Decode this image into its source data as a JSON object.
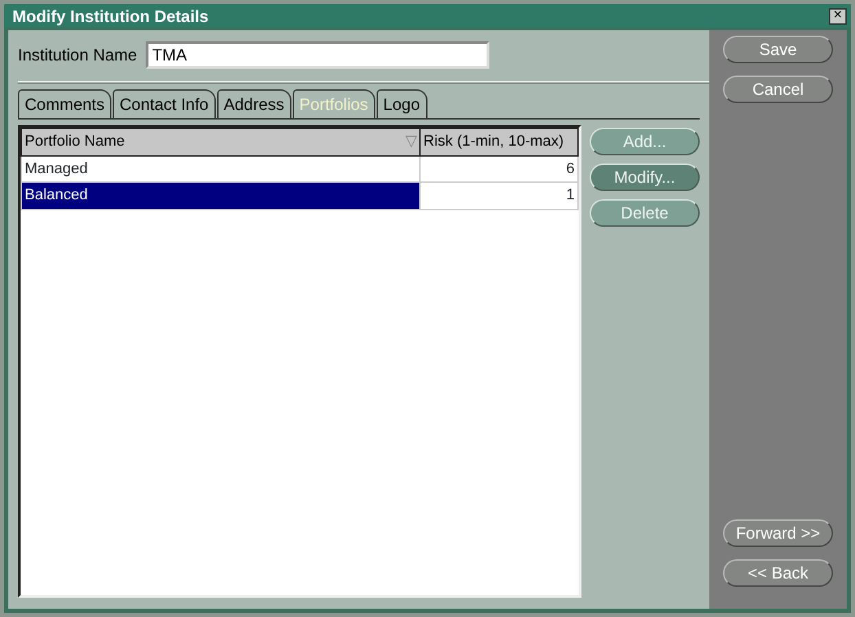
{
  "window": {
    "title": "Modify Institution Details",
    "close": "×"
  },
  "institution_name": {
    "label": "Institution Name",
    "value": "TMA"
  },
  "tabs": [
    {
      "label": "Comments",
      "selected": false
    },
    {
      "label": "Contact Info",
      "selected": false
    },
    {
      "label": "Address",
      "selected": false
    },
    {
      "label": "Portfolios",
      "selected": true
    },
    {
      "label": "Logo",
      "selected": false
    }
  ],
  "table": {
    "columns": [
      {
        "label": "Portfolio Name",
        "sort_indicator": "▽"
      },
      {
        "label": "Risk (1-min, 10-max)"
      }
    ],
    "rows": [
      {
        "cells": [
          "Managed",
          "6"
        ],
        "selected": false
      },
      {
        "cells": [
          "Balanced",
          "1"
        ],
        "selected": true
      }
    ]
  },
  "portfolio_buttons": [
    {
      "label": "Add...",
      "focused": false
    },
    {
      "label": "Modify...",
      "focused": true
    },
    {
      "label": "Delete",
      "focused": false
    }
  ],
  "side_buttons": [
    {
      "label": "Save"
    },
    {
      "label": "Cancel"
    }
  ],
  "nav_buttons": [
    {
      "label": "Forward >>"
    },
    {
      "label": "<< Back"
    }
  ]
}
